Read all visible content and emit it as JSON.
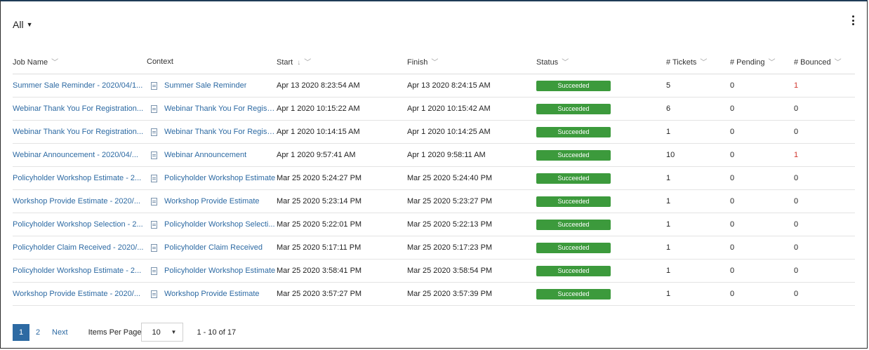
{
  "filter": {
    "label": "All"
  },
  "columns": {
    "job_name": "Job Name",
    "context": "Context",
    "start": "Start",
    "finish": "Finish",
    "status": "Status",
    "tickets": "# Tickets",
    "pending": "# Pending",
    "bounced": "# Bounced"
  },
  "rows": [
    {
      "job": "Summer Sale Reminder - 2020/04/1...",
      "context": "Summer Sale Reminder",
      "start": "Apr 13 2020 8:23:54 AM",
      "finish": "Apr 13 2020 8:24:15 AM",
      "status": "Succeeded",
      "tickets": "5",
      "pending": "0",
      "bounced": "1",
      "bounced_alert": true
    },
    {
      "job": "Webinar Thank You For Registration...",
      "context": "Webinar Thank You For Registr...",
      "start": "Apr 1 2020 10:15:22 AM",
      "finish": "Apr 1 2020 10:15:42 AM",
      "status": "Succeeded",
      "tickets": "6",
      "pending": "0",
      "bounced": "0",
      "bounced_alert": false
    },
    {
      "job": "Webinar Thank You For Registration...",
      "context": "Webinar Thank You For Registr...",
      "start": "Apr 1 2020 10:14:15 AM",
      "finish": "Apr 1 2020 10:14:25 AM",
      "status": "Succeeded",
      "tickets": "1",
      "pending": "0",
      "bounced": "0",
      "bounced_alert": false
    },
    {
      "job": "Webinar Announcement - 2020/04/...",
      "context": "Webinar Announcement",
      "start": "Apr 1 2020 9:57:41 AM",
      "finish": "Apr 1 2020 9:58:11 AM",
      "status": "Succeeded",
      "tickets": "10",
      "pending": "0",
      "bounced": "1",
      "bounced_alert": true
    },
    {
      "job": "Policyholder Workshop Estimate - 2...",
      "context": "Policyholder Workshop Estimate",
      "start": "Mar 25 2020 5:24:27 PM",
      "finish": "Mar 25 2020 5:24:40 PM",
      "status": "Succeeded",
      "tickets": "1",
      "pending": "0",
      "bounced": "0",
      "bounced_alert": false
    },
    {
      "job": "Workshop Provide Estimate - 2020/...",
      "context": "Workshop Provide Estimate",
      "start": "Mar 25 2020 5:23:14 PM",
      "finish": "Mar 25 2020 5:23:27 PM",
      "status": "Succeeded",
      "tickets": "1",
      "pending": "0",
      "bounced": "0",
      "bounced_alert": false
    },
    {
      "job": "Policyholder Workshop Selection - 2...",
      "context": "Policyholder Workshop Selecti...",
      "start": "Mar 25 2020 5:22:01 PM",
      "finish": "Mar 25 2020 5:22:13 PM",
      "status": "Succeeded",
      "tickets": "1",
      "pending": "0",
      "bounced": "0",
      "bounced_alert": false
    },
    {
      "job": "Policyholder Claim Received - 2020/...",
      "context": "Policyholder Claim Received",
      "start": "Mar 25 2020 5:17:11 PM",
      "finish": "Mar 25 2020 5:17:23 PM",
      "status": "Succeeded",
      "tickets": "1",
      "pending": "0",
      "bounced": "0",
      "bounced_alert": false
    },
    {
      "job": "Policyholder Workshop Estimate - 2...",
      "context": "Policyholder Workshop Estimate",
      "start": "Mar 25 2020 3:58:41 PM",
      "finish": "Mar 25 2020 3:58:54 PM",
      "status": "Succeeded",
      "tickets": "1",
      "pending": "0",
      "bounced": "0",
      "bounced_alert": false
    },
    {
      "job": "Workshop Provide Estimate - 2020/...",
      "context": "Workshop Provide Estimate",
      "start": "Mar 25 2020 3:57:27 PM",
      "finish": "Mar 25 2020 3:57:39 PM",
      "status": "Succeeded",
      "tickets": "1",
      "pending": "0",
      "bounced": "0",
      "bounced_alert": false
    }
  ],
  "pagination": {
    "pages": [
      "1",
      "2"
    ],
    "active_page": "1",
    "next_label": "Next",
    "items_per_page_label": "Items Per Page",
    "items_per_page_value": "10",
    "range_text": "1 - 10 of 17"
  },
  "colors": {
    "link": "#2d6aa3",
    "success": "#3c9a3c",
    "alert": "#d0342c"
  },
  "icons": {
    "filter_caret": "caret-down-icon",
    "menu": "kebab-menu-icon",
    "context": "document-icon",
    "sort": "arrow-down-icon"
  }
}
